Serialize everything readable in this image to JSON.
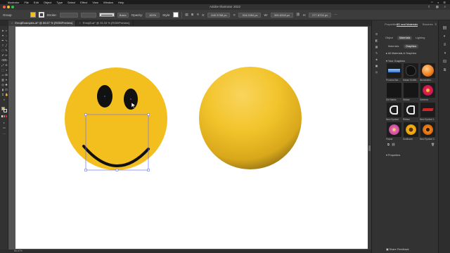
{
  "menubar": {
    "items": [
      "Illustrator",
      "File",
      "Edit",
      "Object",
      "Type",
      "Select",
      "Effect",
      "View",
      "Window",
      "Help"
    ]
  },
  "app_title": "Adobe Illustrator 2022",
  "controlbar": {
    "selection_label": "Group",
    "stroke_label": "Stroke:",
    "stroke_profile_value": "Basic",
    "opacity_label": "Opacity:",
    "opacity_value": "100%",
    "style_label": "Style:",
    "x_value": "640.5788 px",
    "y_value": "318.2284 px",
    "w_value": "309.8318 px",
    "h_value": "277.8724 px"
  },
  "doc_tabs": [
    {
      "label": "EmojiExamples.ai* @ 66.67 % (RGB/Preview)",
      "active": true
    },
    {
      "label": "Emoji3.ai* @ 33.33 % (RGB/Preview)",
      "active": false
    }
  ],
  "panel": {
    "tabs": [
      "Properties",
      "3D and Materials",
      "Brushes"
    ],
    "subtabs": [
      "Object",
      "Materials",
      "Lighting"
    ],
    "material_tabs": [
      "Materials",
      "Graphics"
    ],
    "all_materials_label": "All Materials & Graphics",
    "your_graphics_label": "Your Graphics",
    "properties_label": "Properties",
    "graphics": [
      {
        "label": "Process Bar...",
        "icon": "blue-gradient-graphic"
      },
      {
        "label": "Hasan Scribb...",
        "icon": "ink-splash-graphic"
      },
      {
        "label": "Illuminated...",
        "icon": "orange-sphere-graphic"
      },
      {
        "label": "Dirt Marks",
        "icon": "dark-texture-graphic"
      },
      {
        "label": "Sticker",
        "icon": "sticker-graphic"
      },
      {
        "label": "Gerbera",
        "icon": "red-flower-graphic"
      },
      {
        "label": "New Symbol",
        "icon": "outline-symbol-graphic"
      },
      {
        "label": "Ribbon",
        "icon": "outline-ribbon-graphic"
      },
      {
        "label": "New Symbol 1",
        "icon": "red-ribbon-graphic"
      },
      {
        "label": "Flower",
        "icon": "pink-flower-graphic"
      },
      {
        "label": "Sunflower",
        "icon": "sunflower-graphic"
      },
      {
        "label": "New Symbol 3",
        "icon": "orange-flower-graphic"
      }
    ],
    "share_feedback": "Share Feedback"
  },
  "status": {
    "zoom": "66.67%"
  },
  "colors": {
    "emoji_yellow": "#f3bf1e",
    "sphere_yellow": "#f2c42b",
    "canvas_bg": "#535353",
    "panel_bg": "#323232"
  }
}
